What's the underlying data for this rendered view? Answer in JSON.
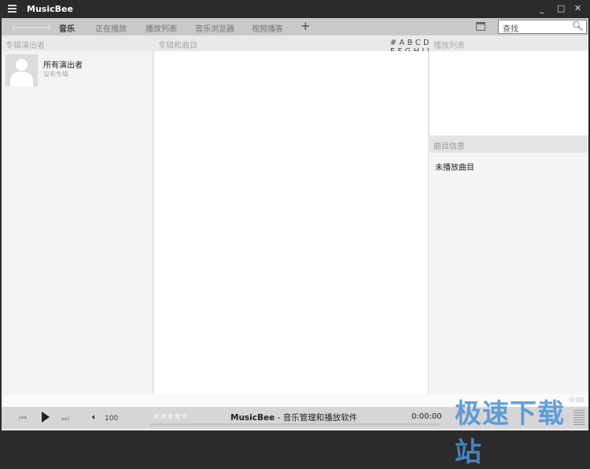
{
  "titlebar": {
    "app_title": "MusicBee",
    "minimize": "_",
    "maximize": "□",
    "close": "✕"
  },
  "tabs": [
    {
      "label": "音乐",
      "active": true
    },
    {
      "label": "正在播放"
    },
    {
      "label": "播放列表"
    },
    {
      "label": "音乐浏览器"
    },
    {
      "label": "视频播客"
    }
  ],
  "tab_add": "+",
  "search": {
    "placeholder": "查找",
    "icon": "search-icon"
  },
  "panels": {
    "artists_header": "专辑演出者",
    "albums_header": "专辑和曲目",
    "alphabet": "# A B C D E F G H I J K L M N O P Q R S T U V W X Y Z",
    "playlist_header": "播放列表",
    "info_header": "曲目信息",
    "info_text": "未播放曲目"
  },
  "artist_list": [
    {
      "name": "所有演出者",
      "sub": "没有专辑"
    }
  ],
  "status": {
    "right_text": "0:00"
  },
  "player": {
    "volume": "100",
    "rating": 0,
    "app_name": "MusicBee",
    "separator": " - ",
    "subtitle": "音乐管理和播放软件",
    "time": "0:00:00",
    "accent": "#222222"
  },
  "watermark": "极速下载站"
}
